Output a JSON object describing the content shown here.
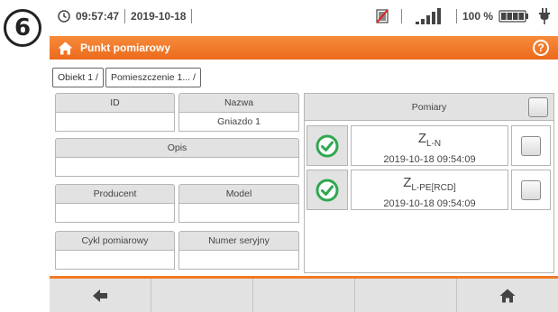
{
  "step_number": "6",
  "status": {
    "time": "09:57:47",
    "date": "2019-10-18",
    "battery_percent": "100 %"
  },
  "title_bar": {
    "title": "Punkt pomiarowy",
    "help_label": "?"
  },
  "breadcrumb": [
    "Obiekt 1 /",
    "Pomieszczenie 1... /"
  ],
  "form": {
    "id": {
      "label": "ID",
      "value": ""
    },
    "nazwa": {
      "label": "Nazwa",
      "value": "Gniazdo 1"
    },
    "opis": {
      "label": "Opis",
      "value": ""
    },
    "producent": {
      "label": "Producent",
      "value": ""
    },
    "model": {
      "label": "Model",
      "value": ""
    },
    "cykl": {
      "label": "Cykl pomiarowy",
      "value": ""
    },
    "numer": {
      "label": "Numer seryjny",
      "value": ""
    }
  },
  "measurements": {
    "header": "Pomiary",
    "rows": [
      {
        "symbol": "Z",
        "subscript": "L-N",
        "timestamp": "2019-10-18 09:54:09",
        "status": "ok"
      },
      {
        "symbol": "Z",
        "subscript": "L-PE[RCD]",
        "timestamp": "2019-10-18 09:54:09",
        "status": "ok"
      }
    ]
  },
  "colors": {
    "accent": "#ec6a1c",
    "ok_green": "#2fa84f"
  },
  "icons": {
    "back": "arrow-left-icon",
    "home": "home-icon"
  }
}
